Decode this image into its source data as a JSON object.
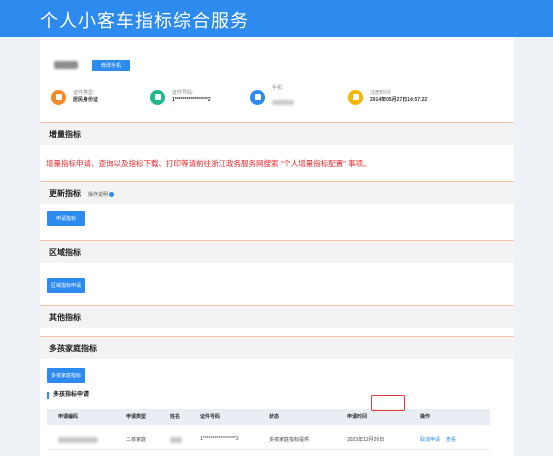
{
  "header": {
    "title": "个人小客车指标综合服务"
  },
  "user": {
    "modify_phone_button": "修改手机",
    "info": [
      {
        "label": "证件类型:",
        "value": "居民身份证",
        "color": "#f5892a"
      },
      {
        "label": "证件号码:",
        "value": "1*****************2",
        "color": "#1fb98a"
      },
      {
        "label": "手机:",
        "value": "",
        "color": "#2d8bf0"
      },
      {
        "label": "注册时间:",
        "value": "2014年05月27日14:57:22",
        "color": "#f7b500"
      }
    ]
  },
  "sections": {
    "increment": {
      "title": "增量指标",
      "notice": "增量指标申请、查询以及指标下载、打印等请前往浙江政务服务网搜索 \"个人增量指标配置\" 事项。"
    },
    "renewal": {
      "title": "更新指标",
      "help": "操作说明",
      "button": "申请指标"
    },
    "regional": {
      "title": "区域指标",
      "button": "区域指标申请"
    },
    "other": {
      "title": "其他指标"
    },
    "multichild": {
      "title": "多孩家庭指标",
      "button": "多孩家庭指标"
    }
  },
  "table": {
    "title": "多孩指标申请",
    "headers": [
      "申请编码",
      "申请类型",
      "姓名",
      "证件号码",
      "状态",
      "申请时间",
      "操作"
    ],
    "rows": [
      {
        "type": "二孩家庭",
        "id_number": "1*****************2",
        "status": "多孩家庭指标提供",
        "time": "2023年12月26日",
        "actions": [
          "取消申请",
          "查看"
        ]
      }
    ]
  }
}
